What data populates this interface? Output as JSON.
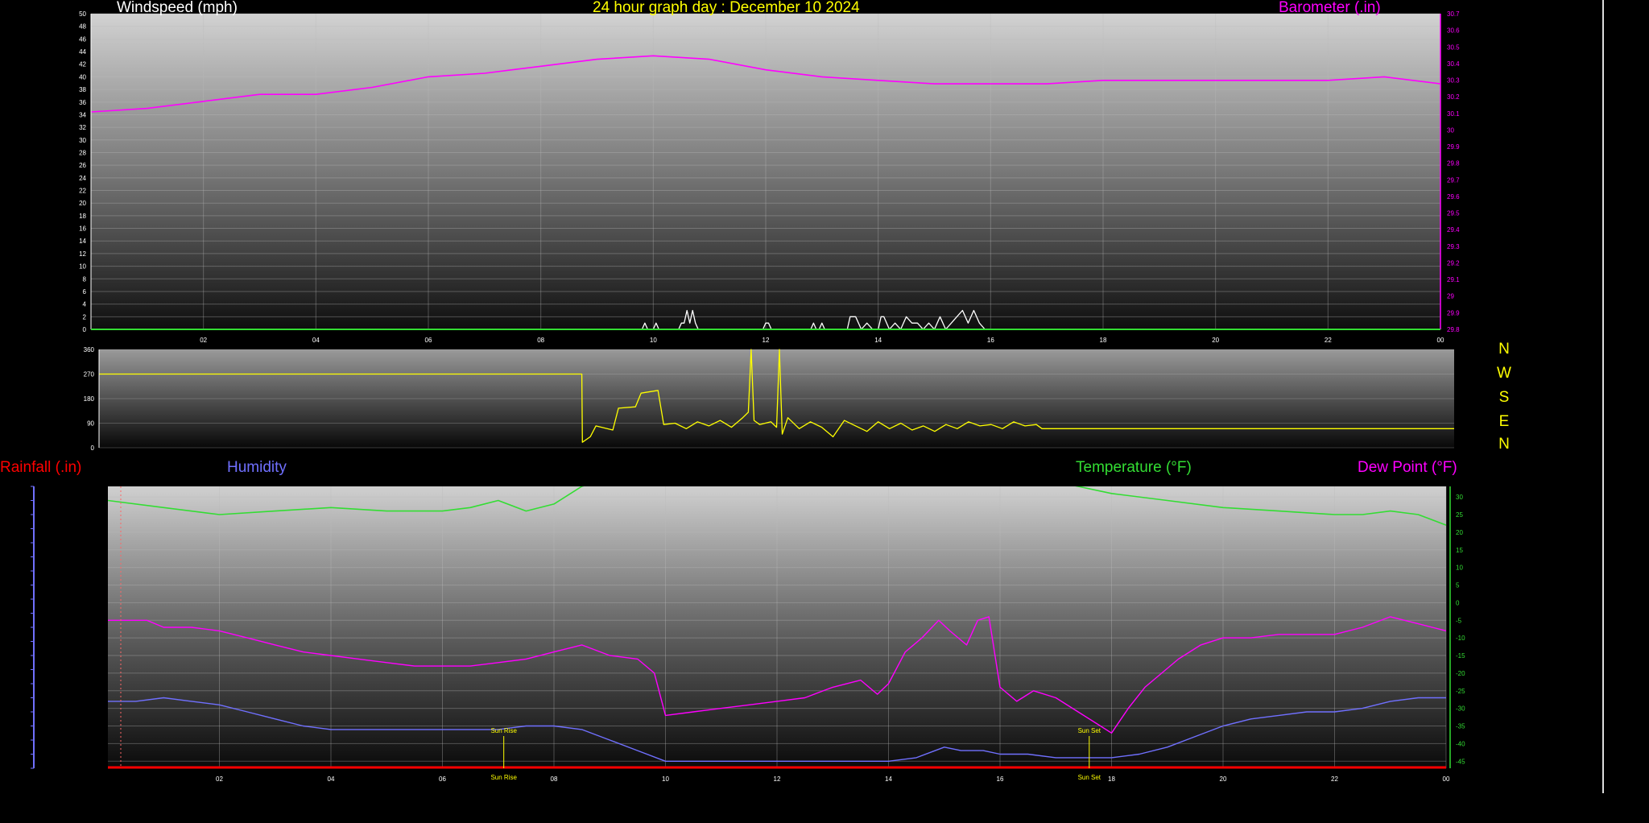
{
  "page": {
    "title": "24 hour graph day : December 10 2024",
    "colors": {
      "title": "#ffff00",
      "windspeed": "#ffffff",
      "barometer": "#ff00ff",
      "direction": "#ffff00",
      "rainfall": "#ff0000",
      "humidity": "#7070ff",
      "temperature": "#33dd33",
      "dewpoint": "#ff00ff"
    }
  },
  "wind_chart": {
    "left_label": "Windspeed (mph)",
    "right_label": "Barometer (.in)"
  },
  "direction_chart": {
    "compass": [
      "N",
      "W",
      "S",
      "E",
      "N"
    ]
  },
  "weather_chart": {
    "rain_label": "Rainfall (.in)",
    "humidity_label": "Humidity",
    "temperature_label": "Temperature (°F)",
    "dewpoint_label": "Dew Point (°F)",
    "sunrise_label": "Sun Rise",
    "sunset_label": "Sun Set"
  },
  "chart_data": [
    {
      "type": "line",
      "title": "24 hour graph day : December 10 2024",
      "x_ticks": [
        "02",
        "04",
        "06",
        "08",
        "10",
        "12",
        "14",
        "16",
        "18",
        "20",
        "22",
        "00"
      ],
      "xlim": [
        0,
        24
      ],
      "y_label": "Windspeed (mph)",
      "ylim": [
        0,
        50
      ],
      "y_ticks": [
        0,
        2,
        4,
        6,
        8,
        10,
        12,
        14,
        16,
        18,
        20,
        22,
        24,
        26,
        28,
        30,
        32,
        34,
        36,
        38,
        40,
        42,
        44,
        46,
        48,
        50
      ],
      "y2_label": "Barometer (.in)",
      "y2lim": [
        29.8,
        30.7
      ],
      "y2_ticks": [
        "29.8",
        "29.9",
        "29",
        "29.1",
        "29.2",
        "29.3",
        "29.4",
        "29.5",
        "29.6",
        "29.7",
        "29.8",
        "29.9",
        "30",
        "30.1",
        "30.2",
        "30.3",
        "30.4",
        "30.5",
        "30.6",
        "30.7"
      ],
      "grid": true,
      "series": [
        {
          "name": "Windspeed (mph)",
          "axis": "left",
          "x": [
            0,
            9.8,
            9.85,
            9.9,
            10,
            10.05,
            10.1,
            10.45,
            10.5,
            10.55,
            10.6,
            10.65,
            10.7,
            10.75,
            10.8,
            11.95,
            12,
            12.05,
            12.1,
            12.8,
            12.85,
            12.9,
            12.95,
            13,
            13.05,
            13.1,
            13.45,
            13.5,
            13.6,
            13.7,
            13.8,
            13.9,
            14.0,
            14.05,
            14.1,
            14.2,
            14.3,
            14.4,
            14.5,
            14.6,
            14.7,
            14.8,
            14.9,
            15.0,
            15.1,
            15.2,
            15.3,
            15.4,
            15.5,
            15.6,
            15.7,
            15.8,
            15.9,
            16,
            24
          ],
          "y": [
            0,
            0,
            1,
            0,
            0,
            1,
            0,
            0,
            1,
            1,
            3,
            1,
            3,
            1,
            0,
            0,
            1,
            1,
            0,
            0,
            1,
            0,
            0,
            1,
            0,
            0,
            0,
            2,
            2,
            0,
            1,
            0,
            0,
            2,
            2,
            0,
            1,
            0,
            2,
            1,
            1,
            0,
            1,
            0,
            2,
            0,
            1,
            2,
            3,
            1,
            3,
            1,
            0,
            0,
            0
          ]
        },
        {
          "name": "Barometer (.in)",
          "axis": "right",
          "x": [
            0,
            1,
            2,
            3,
            4,
            5,
            6,
            7,
            8,
            9,
            10,
            11,
            12,
            13,
            14,
            15,
            16,
            17,
            18,
            19,
            20,
            21,
            22,
            23,
            24
          ],
          "y": [
            30.42,
            30.43,
            30.45,
            30.47,
            30.47,
            30.49,
            30.52,
            30.53,
            30.55,
            30.57,
            30.58,
            30.57,
            30.54,
            30.52,
            30.51,
            30.5,
            30.5,
            30.5,
            30.51,
            30.51,
            30.51,
            30.51,
            30.51,
            30.52,
            30.5
          ]
        }
      ]
    },
    {
      "type": "line",
      "y_label": "Wind direction (degrees)",
      "ylim": [
        0,
        360
      ],
      "y_ticks": [
        0,
        90,
        180,
        270,
        360
      ],
      "xlim": [
        0,
        24
      ],
      "grid": true,
      "series": [
        {
          "name": "Wind direction",
          "x": [
            0,
            8.55,
            8.56,
            8.7,
            8.8,
            9.1,
            9.2,
            9.5,
            9.6,
            9.9,
            10.0,
            10.2,
            10.4,
            10.6,
            10.8,
            11.0,
            11.2,
            11.4,
            11.5,
            11.55,
            11.6,
            11.7,
            11.9,
            12.0,
            12.05,
            12.1,
            12.2,
            12.4,
            12.6,
            12.8,
            13.0,
            13.2,
            13.4,
            13.6,
            13.8,
            14.0,
            14.2,
            14.4,
            14.6,
            14.8,
            15.0,
            15.2,
            15.4,
            15.6,
            15.8,
            16.0,
            16.2,
            16.4,
            16.6,
            16.7,
            17.0,
            24
          ],
          "y": [
            270,
            270,
            20,
            40,
            80,
            65,
            145,
            150,
            200,
            210,
            85,
            90,
            70,
            95,
            80,
            100,
            75,
            110,
            130,
            360,
            100,
            85,
            95,
            75,
            360,
            50,
            110,
            70,
            95,
            75,
            40,
            100,
            80,
            60,
            95,
            70,
            90,
            65,
            80,
            60,
            85,
            70,
            95,
            80,
            85,
            70,
            95,
            80,
            85,
            70,
            70,
            70
          ]
        }
      ]
    },
    {
      "type": "line",
      "x_ticks": [
        "02",
        "04",
        "06",
        "08",
        "10",
        "12",
        "14",
        "16",
        "18",
        "20",
        "22",
        "00"
      ],
      "xlim": [
        0,
        24
      ],
      "y2_label": "Temperature (°F)",
      "y2lim": [
        -47,
        33
      ],
      "y2_ticks": [
        30,
        25,
        20,
        15,
        10,
        5,
        0,
        -5,
        -10,
        -15,
        -20,
        -25,
        -30,
        -35,
        -40,
        -45
      ],
      "grid": true,
      "annotations": [
        {
          "label": "Sun Rise",
          "x": 7.1
        },
        {
          "label": "Sun Set",
          "x": 17.6
        }
      ],
      "series": [
        {
          "name": "Temperature (°F)",
          "x": [
            0,
            1,
            2,
            3,
            4,
            5,
            6,
            6.5,
            7,
            7.5,
            8,
            8.5,
            8.7,
            17.1,
            17.4,
            18,
            19,
            20,
            21,
            22,
            22.5,
            23,
            23.5,
            24
          ],
          "y": [
            29,
            27,
            25,
            26,
            27,
            26,
            26,
            27,
            29,
            26,
            28,
            33,
            34,
            34,
            33,
            31,
            29,
            27,
            26,
            25,
            25,
            26,
            25,
            22
          ]
        },
        {
          "name": "Dew Point (°F)",
          "x": [
            0,
            0.7,
            1,
            1.5,
            2,
            2.5,
            3,
            3.5,
            4,
            4.5,
            5,
            5.5,
            6,
            6.5,
            7,
            7.5,
            8,
            8.5,
            9,
            9.5,
            9.8,
            10,
            10.5,
            11,
            11.5,
            12,
            12.5,
            13,
            13.5,
            13.8,
            14,
            14.3,
            14.6,
            14.9,
            15.1,
            15.4,
            15.6,
            15.8,
            16,
            16.3,
            16.6,
            17,
            17.4,
            17.8,
            18,
            18.3,
            18.6,
            18.9,
            19.2,
            19.6,
            20,
            20.5,
            21,
            21.5,
            22,
            22.5,
            23,
            23.5,
            24
          ],
          "y": [
            -5,
            -5,
            -7,
            -7,
            -8,
            -10,
            -12,
            -14,
            -15,
            -16,
            -17,
            -18,
            -18,
            -18,
            -17,
            -16,
            -14,
            -12,
            -15,
            -16,
            -20,
            -32,
            -31,
            -30,
            -29,
            -28,
            -27,
            -24,
            -22,
            -26,
            -23,
            -14,
            -10,
            -5,
            -8,
            -12,
            -5,
            -4,
            -24,
            -28,
            -25,
            -27,
            -31,
            -35,
            -37,
            -30,
            -24,
            -20,
            -16,
            -12,
            -10,
            -10,
            -9,
            -9,
            -9,
            -7,
            -4,
            -6,
            -8
          ]
        },
        {
          "name": "Humidity",
          "x": [
            0,
            0.5,
            1,
            1.5,
            2,
            2.5,
            3,
            3.5,
            4,
            4.5,
            5,
            5.5,
            6,
            6.5,
            7,
            7.5,
            8,
            8.5,
            9,
            9.5,
            10,
            10.5,
            11,
            12,
            13,
            14,
            14.5,
            15,
            15.3,
            15.7,
            16,
            16.5,
            17,
            17.5,
            18,
            18.5,
            19,
            19.5,
            20,
            20.5,
            21,
            21.5,
            22,
            22.5,
            23,
            23.5,
            24
          ],
          "y": [
            -28,
            -28,
            -27,
            -28,
            -29,
            -31,
            -33,
            -35,
            -36,
            -36,
            -36,
            -36,
            -36,
            -36,
            -36,
            -35,
            -35,
            -36,
            -39,
            -42,
            -45,
            -45,
            -45,
            -45,
            -45,
            -45,
            -44,
            -41,
            -42,
            -42,
            -43,
            -43,
            -44,
            -44,
            -44,
            -43,
            -41,
            -38,
            -35,
            -33,
            -32,
            -31,
            -31,
            -30,
            -28,
            -27,
            -27
          ]
        },
        {
          "name": "Rainfall (.in)",
          "x": [
            0,
            24
          ],
          "y": [
            -47,
            -47
          ]
        }
      ]
    }
  ]
}
